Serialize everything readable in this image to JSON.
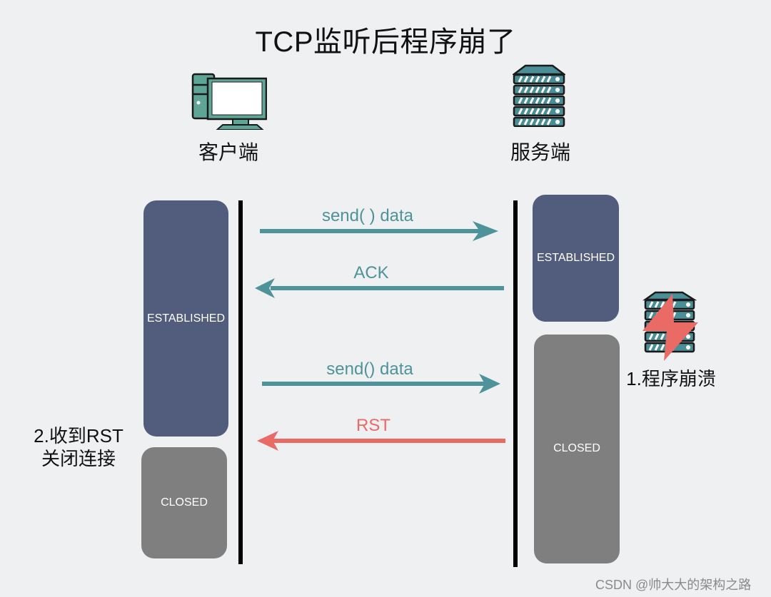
{
  "title": "TCP监听后程序崩了",
  "colors": {
    "background": "#eff0f2",
    "established": "#525d7e",
    "closed": "#7f7f7f",
    "normal_arrow": "#4e9399",
    "rst_arrow": "#ea6a66",
    "icon_fill": "#5fa595",
    "server_icon_fill": "#4a8f98"
  },
  "client": {
    "label": "客户端",
    "icon": "computer-icon",
    "states": [
      {
        "label": "ESTABLISHED",
        "type": "established"
      },
      {
        "label": "CLOSED",
        "type": "closed"
      }
    ],
    "note_line1": "2.收到RST",
    "note_line2": "关闭连接"
  },
  "server": {
    "label": "服务端",
    "icon": "server-icon",
    "states": [
      {
        "label": "ESTABLISHED",
        "type": "established"
      },
      {
        "label": "CLOSED",
        "type": "closed"
      }
    ],
    "crash_icon": "crashed-server-icon",
    "crash_note": "1.程序崩溃"
  },
  "messages": [
    {
      "label": "send( ) data",
      "direction": "client-to-server",
      "kind": "normal"
    },
    {
      "label": "ACK",
      "direction": "server-to-client",
      "kind": "normal"
    },
    {
      "label": "send() data",
      "direction": "client-to-server",
      "kind": "normal"
    },
    {
      "label": "RST",
      "direction": "server-to-client",
      "kind": "rst"
    }
  ],
  "watermark": "CSDN @帅大大的架构之路"
}
